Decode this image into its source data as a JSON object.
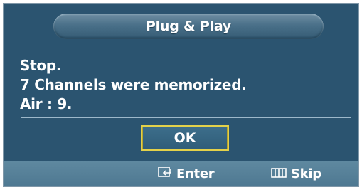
{
  "dialog": {
    "title": "Plug & Play",
    "lines": [
      "Stop.",
      "7 Channels were memorized.",
      "Air  : 9."
    ],
    "ok_label": "OK"
  },
  "footer": {
    "enter_label": "Enter",
    "enter_icon": "enter-icon",
    "skip_label": "Skip",
    "skip_icon": "menu-icon"
  },
  "colors": {
    "panel": "#2b5470",
    "bottom_bar": "#5f89a0",
    "ok_border": "#e3d14a",
    "text": "#ffffff"
  }
}
